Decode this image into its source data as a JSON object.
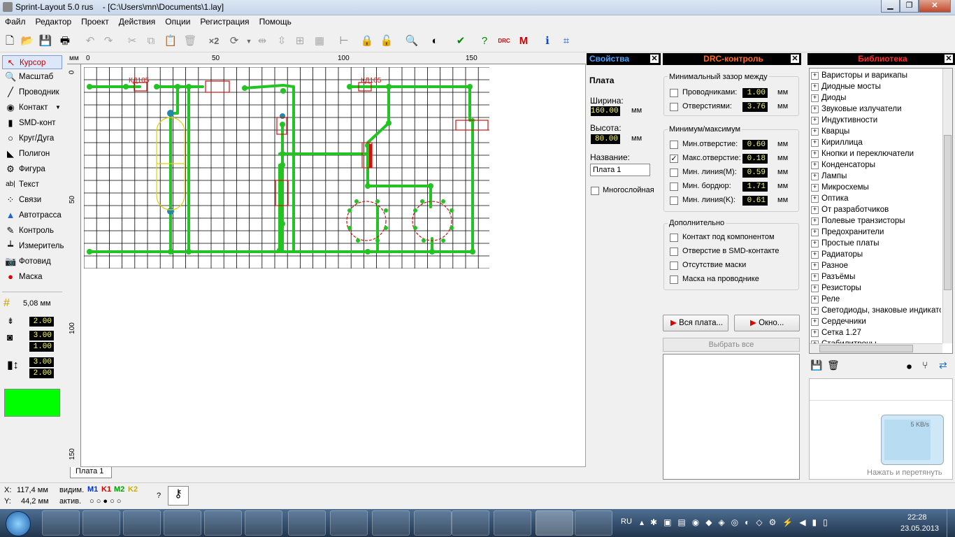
{
  "window": {
    "title": "Sprint-Layout 5.0 rus",
    "path": "- [C:\\Users\\mn\\Documents\\1.lay]"
  },
  "menu": [
    "Файл",
    "Редактор",
    "Проект",
    "Действия",
    "Опции",
    "Регистрация",
    "Помощь"
  ],
  "toolbar": {
    "x2_label": "×2"
  },
  "tools": [
    {
      "label": "Курсор",
      "icon": "cursor-icon",
      "selected": true
    },
    {
      "label": "Масштаб",
      "icon": "magnifier-icon"
    },
    {
      "label": "Проводник",
      "icon": "track-icon"
    },
    {
      "label": "Контакт",
      "icon": "pad-icon"
    },
    {
      "label": "SMD-конт",
      "icon": "smd-pad-icon"
    },
    {
      "label": "Круг/Дуга",
      "icon": "circle-icon"
    },
    {
      "label": "Полигон",
      "icon": "polygon-icon"
    },
    {
      "label": "Фигура",
      "icon": "shape-icon"
    },
    {
      "label": "Текст",
      "icon": "text-icon"
    },
    {
      "label": "Связи",
      "icon": "connections-icon"
    },
    {
      "label": "Автотрасса",
      "icon": "autoroute-icon"
    },
    {
      "label": "Контроль",
      "icon": "control-icon"
    },
    {
      "label": "Измеритель",
      "icon": "measure-icon"
    },
    {
      "label": "Фотовид",
      "icon": "photoview-icon"
    },
    {
      "label": "Маска",
      "icon": "mask-icon"
    }
  ],
  "params": {
    "grid": "5,08 мм",
    "track_width": "2.00",
    "pad_outer": "3.00",
    "pad_inner": "1.00",
    "smd_w": "3.00",
    "smd_h": "2.00",
    "layer_color": "#00ff00"
  },
  "ruler": {
    "unit": "мм",
    "h": [
      "0",
      "50",
      "100",
      "150"
    ],
    "v": [
      "0",
      "50",
      "100",
      "150"
    ]
  },
  "board_labels": {
    "part1": "КД105",
    "part2": "КД105"
  },
  "tab": "Плата 1",
  "status": {
    "x_label": "X:",
    "x": "117,4 мм",
    "y_label": "Y:",
    "y": "44,2 мм",
    "vis": "видим.",
    "act": "актив.",
    "layers": [
      "M1",
      "K1",
      "M2",
      "K2"
    ],
    "help": "?"
  },
  "props": {
    "header": "Свойства",
    "section": "Плата",
    "width_label": "Ширина:",
    "width": "160.00",
    "unit": "мм",
    "height_label": "Высота:",
    "height": "80.00",
    "name_label": "Название:",
    "name": "Плата 1",
    "multilayer": "Многослойная"
  },
  "drc": {
    "header": "DRC-контроль",
    "gap_title": "Минимальный зазор между",
    "gap_rows": [
      {
        "label": "Проводниками:",
        "value": "1.00",
        "checked": false
      },
      {
        "label": "Отверстиями:",
        "value": "3.76",
        "checked": false
      }
    ],
    "minmax_title": "Минимум/максимум",
    "minmax_rows": [
      {
        "label": "Мин.отверстие:",
        "value": "0.60",
        "checked": false
      },
      {
        "label": "Макс.отверстие:",
        "value": "0.18",
        "checked": true
      },
      {
        "label": "Мин. линия(M):",
        "value": "0.59",
        "checked": false
      },
      {
        "label": "Мин. бордюр:",
        "value": "1.71",
        "checked": false
      },
      {
        "label": "Мин. линия(K):",
        "value": "0.61",
        "checked": false
      }
    ],
    "extra_title": "Дополнительно",
    "extra_rows": [
      "Контакт под компонентом",
      "Отверстие в SMD-контакте",
      "Отсутствие маски",
      "Маска на проводнике"
    ],
    "unit": "мм",
    "btn_all": "Вся плата...",
    "btn_window": "Окно...",
    "btn_select": "Выбрать все"
  },
  "library": {
    "header": "Библиотека",
    "items": [
      "Варисторы и варикапы",
      "Диодные мосты",
      "Диоды",
      "Звуковые излучатели",
      "Индуктивности",
      "Кварцы",
      "Кириллица",
      "Кнопки и переключатели",
      "Конденсаторы",
      "Лампы",
      "Микросхемы",
      "Оптика",
      "От разработчиков",
      "Полевые транзисторы",
      "Предохранители",
      "Простые платы",
      "Радиаторы",
      "Разное",
      "Разъёмы",
      "Резисторы",
      "Реле",
      "Светодиоды, знаковые индикато",
      "Сердечники",
      "Сетка 1.27",
      "Стабилитроны"
    ],
    "drag_hint": "Нажать и перетянуть",
    "net_speed": "5 KB/s"
  },
  "taskbar": {
    "lang": "RU",
    "time": "22:28",
    "date": "23.05.2013"
  }
}
